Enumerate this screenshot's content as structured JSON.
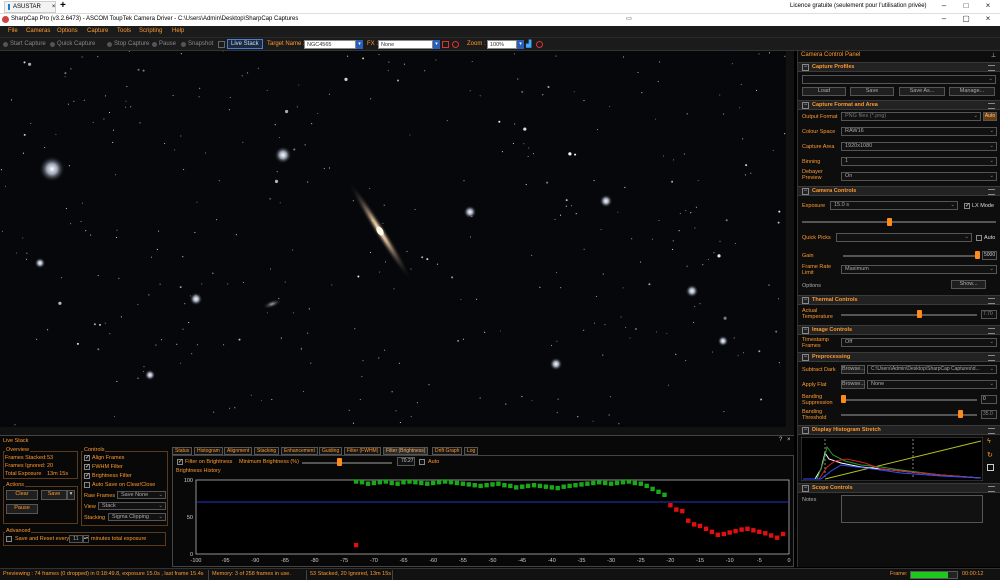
{
  "browser": {
    "tab": "ASUSTAR",
    "new_tab": "+",
    "license": "Licence gratuite (seulement pour l'utilisation privée)"
  },
  "window": {
    "title": "SharpCap Pro (v3.2.6473) - ASCOM ToupTek Camera Driver - C:\\Users\\Admin\\Desktop\\SharpCap Captures"
  },
  "menu": [
    "File",
    "Cameras",
    "Options",
    "Capture",
    "Tools",
    "Scripting",
    "Help"
  ],
  "toolbar": {
    "start_capture": "Start Capture",
    "quick_capture": "Quick Capture",
    "stop_capture": "Stop Capture",
    "pause": "Pause",
    "snapshot": "Snapshot",
    "live_stack": "Live Stack",
    "target_name_label": "Target Name :",
    "target_name": "NGC4565",
    "fx_label": "FX :",
    "fx_value": "None",
    "zoom_label": "Zoom :",
    "zoom_value": "100%"
  },
  "ccp": {
    "title": "Camera Control Panel",
    "capture_profiles": {
      "title": "Capture Profiles",
      "load": "Load",
      "save": "Save",
      "save_as": "Save As...",
      "manage": "Manage..."
    },
    "capture_format": {
      "title": "Capture Format and Area",
      "output_format_label": "Output Format",
      "output_format": "PNG files (*.png)",
      "auto": "Auto",
      "colour_space_label": "Colour Space",
      "colour_space": "RAW16",
      "capture_area_label": "Capture Area",
      "capture_area": "1920x1080",
      "binning_label": "Binning",
      "binning": "1",
      "debayer_label": "Debayer Preview",
      "debayer": "On"
    },
    "camera_controls": {
      "title": "Camera Controls",
      "exposure_label": "Exposure",
      "exposure": "15.0 s",
      "lx_mode": "LX Mode",
      "quick_picks_label": "Quick Picks",
      "quick_picks_auto": "Auto",
      "gain_label": "Gain",
      "gain": "5000",
      "frame_rate_label": "Frame Rate Limit",
      "frame_rate": "Maximum",
      "options_label": "Options",
      "show": "Show..."
    },
    "thermal": {
      "title": "Thermal Controls",
      "actual_temp_label": "Actual Temperature",
      "actual_temp": "7.70"
    },
    "image_controls": {
      "title": "Image Controls",
      "timestamp_label": "Timestamp Frames",
      "timestamp": "Off"
    },
    "preprocessing": {
      "title": "Preprocessing",
      "subtract_dark_label": "Subtract Dark",
      "browse": "Browse...",
      "dark_path": "C:\\Users\\Admin\\Desktop\\SharpCap Captures\\d...",
      "apply_flat_label": "Apply Flat",
      "flat_value": "None",
      "banding_supp_label": "Banding Suppression",
      "banding_supp": "0",
      "banding_thresh_label": "Banding Threshold",
      "banding_thresh": "35.0"
    },
    "histogram": {
      "title": "Display Histogram Stretch"
    },
    "scope": {
      "title": "Scope Controls",
      "notes_label": "Notes"
    }
  },
  "livestack": {
    "title": "Live Stack",
    "overview": {
      "title": "Overview",
      "frames_stacked_label": "Frames Stacked:",
      "frames_stacked": "53",
      "frames_ignored_label": "Frames Ignored:",
      "frames_ignored": "20",
      "total_exposure_label": "Total Exposure",
      "total_exposure": "13m 15s"
    },
    "actions": {
      "title": "Actions",
      "clear": "Clear",
      "save": "Save",
      "pause": "Pause"
    },
    "advanced": {
      "title": "Advanced",
      "save_reset_label": "Save and Reset every",
      "save_reset_value": "11",
      "minutes_label": "minutes total exposure"
    },
    "controls": {
      "title": "Controls",
      "align_frames": "Align Frames",
      "fwhm_filter": "FWHM Filter",
      "brightness_filter": "Brightness Filter",
      "auto_save": "Auto Save on Clear/Close",
      "raw_frames_label": "Raw Frames",
      "raw_frames": "Save None",
      "view_label": "View",
      "view": "Stack",
      "stacking_label": "Stacking",
      "stacking": "Sigma Clipping"
    },
    "tabs": [
      "Status",
      "Histogram",
      "Alignment",
      "Stacking",
      "Enhancement",
      "Guiding",
      "Filter (FWHM)",
      "Filter (Brightness)",
      "Drift Graph",
      "Log"
    ],
    "filter": {
      "filter_on_brightness": "Filter on Brightness",
      "min_brightness_label": "Minimum Brightness (%)",
      "min_brightness": "70.27",
      "auto": "Auto",
      "history_label": "Brightness History"
    }
  },
  "chart_data": {
    "type": "scatter",
    "title": "Brightness History",
    "xlabel": "",
    "ylabel": "",
    "xlim": [
      -100,
      0
    ],
    "ylim": [
      0,
      100
    ],
    "x_ticks": [
      -100,
      -95,
      -90,
      -85,
      -80,
      -75,
      -70,
      -65,
      -60,
      -55,
      -50,
      -45,
      -40,
      -35,
      -30,
      -25,
      -20,
      -15,
      -10,
      -5,
      0
    ],
    "y_ticks": [
      0,
      50,
      100
    ],
    "threshold": 70.27,
    "colors": {
      "accepted": "#1aa81a",
      "rejected": "#e01010",
      "threshold": "#3344ff"
    },
    "series": [
      {
        "name": "",
        "status": "accepted",
        "x": [
          -73,
          -72,
          -71,
          -70,
          -69,
          -68,
          -67,
          -66,
          -65,
          -64,
          -63,
          -62,
          -61,
          -60,
          -59,
          -58,
          -57,
          -56,
          -55,
          -54,
          -53,
          -52,
          -51,
          -50,
          -49,
          -48,
          -47,
          -46,
          -45,
          -44,
          -43,
          -42,
          -41,
          -40,
          -39,
          -38,
          -37,
          -36,
          -35,
          -34,
          -33,
          -32,
          -31,
          -30,
          -29,
          -28,
          -27,
          -26,
          -25,
          -24,
          -23,
          -22,
          -21
        ],
        "y": [
          98,
          97,
          95,
          96,
          97,
          98,
          96,
          95,
          97,
          98,
          97,
          96,
          95,
          96,
          97,
          98,
          97,
          96,
          95,
          94,
          93,
          92,
          93,
          94,
          95,
          93,
          92,
          90,
          91,
          92,
          93,
          92,
          91,
          90,
          89,
          91,
          92,
          93,
          94,
          95,
          96,
          97,
          96,
          95,
          96,
          97,
          98,
          96,
          95,
          92,
          88,
          84,
          80
        ]
      },
      {
        "name": "",
        "status": "rejected",
        "x": [
          -73,
          -20,
          -19,
          -18,
          -17,
          -16,
          -15,
          -14,
          -13,
          -12,
          -11,
          -10,
          -9,
          -8,
          -7,
          -6,
          -5,
          -4,
          -3,
          -2,
          -1
        ],
        "y": [
          12,
          66,
          60,
          58,
          45,
          40,
          38,
          34,
          30,
          26,
          27,
          29,
          31,
          33,
          34,
          32,
          30,
          28,
          25,
          22,
          27
        ]
      }
    ]
  },
  "status": {
    "previewing": "Previewing : 74 frames (0 dropped) in 0:18:49.8, exposure 15.0s , last frame 15.4s",
    "memory": "Memory: 3 of 258 frames in use.",
    "stacked": "53 Stacked, 20 Ignored, 13m 15s",
    "frame_label": "Frame:",
    "frame_time": "00:00:12",
    "frame_progress": 0.8
  }
}
